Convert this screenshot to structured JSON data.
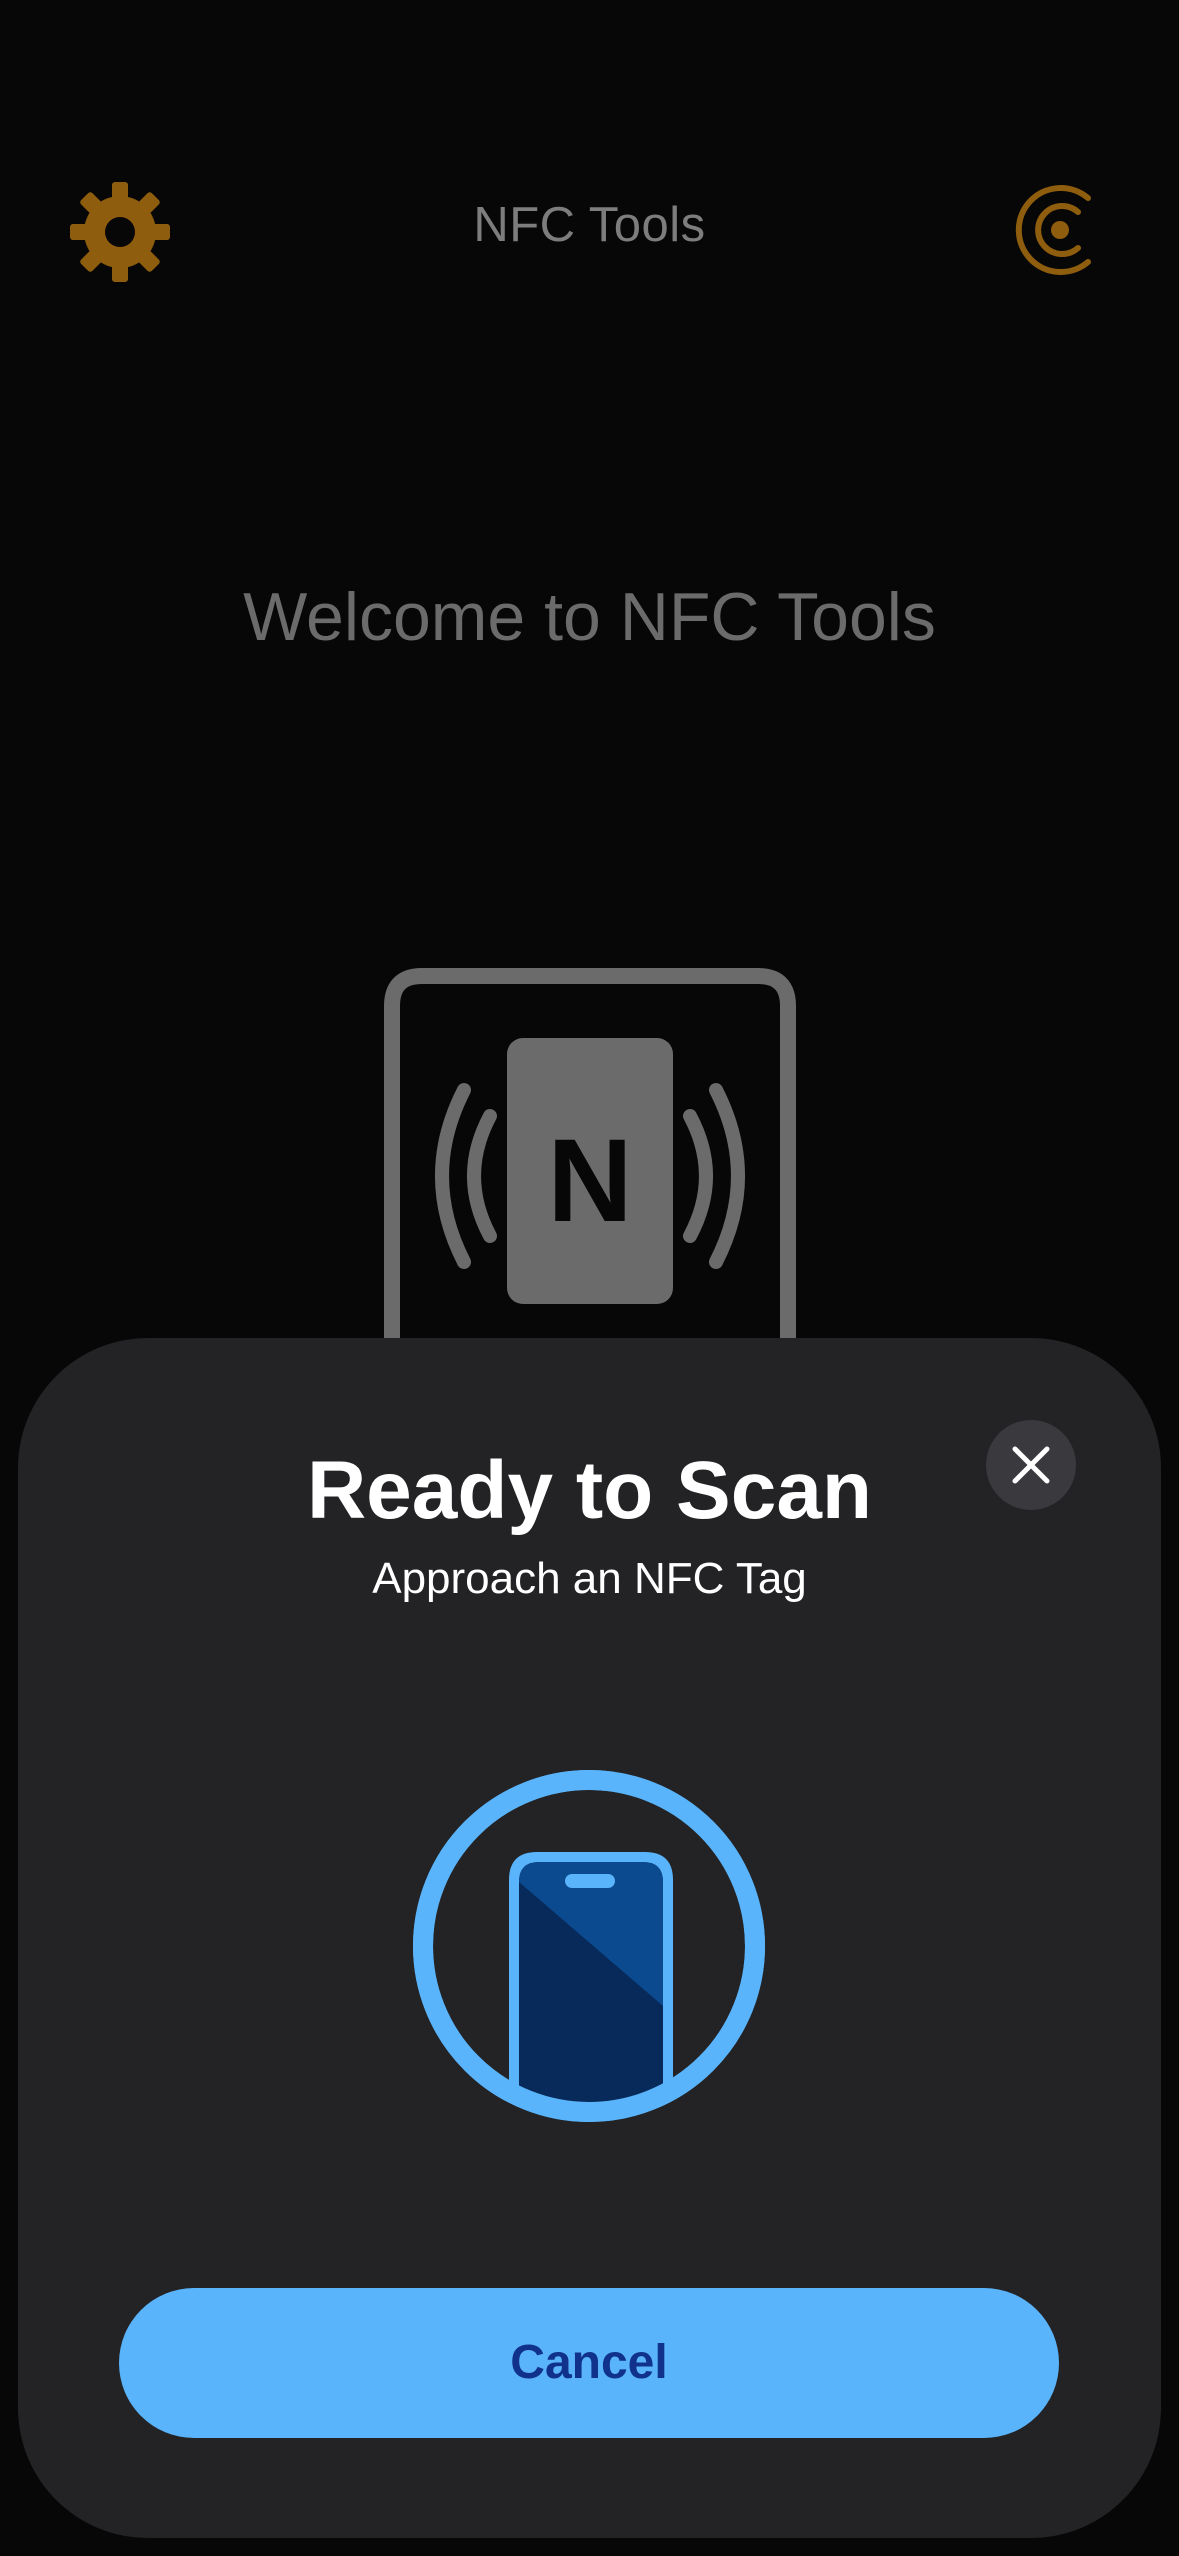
{
  "app": {
    "title": "NFC Tools",
    "welcome": "Welcome to NFC Tools",
    "tag_letter": "N",
    "settings_icon": "gear-icon",
    "pro_icon": "crescent-pro-icon",
    "accent_color": "#9a6410"
  },
  "scan_sheet": {
    "title": "Ready to Scan",
    "subtitle": "Approach an NFC Tag",
    "cancel_label": "Cancel",
    "close_icon": "close-icon",
    "illustration_icon": "phone-scan-icon",
    "button_color": "#5ab4fb",
    "button_text_color": "#10328a"
  }
}
